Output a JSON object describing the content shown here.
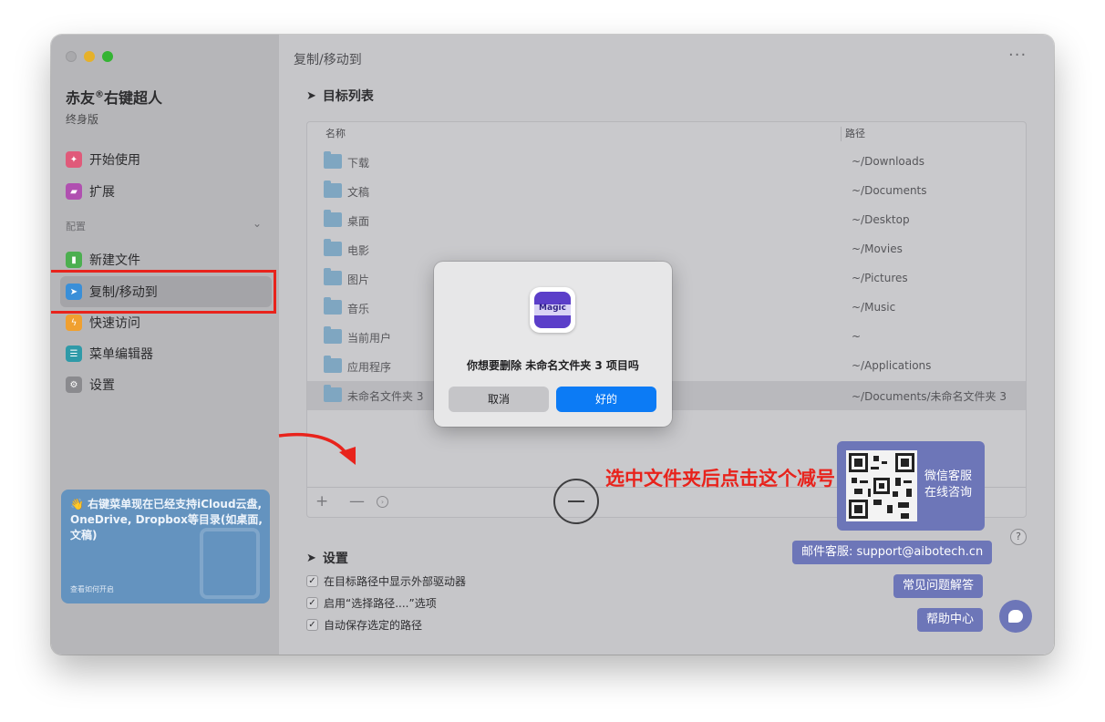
{
  "app": {
    "name": "赤友",
    "registered_mark": "®",
    "name_suffix": "右键超人",
    "edition": "终身版"
  },
  "sidebar": {
    "items_top": [
      {
        "label": "开始使用",
        "icon": "lightbulb-icon",
        "color": "#e05a7a"
      },
      {
        "label": "扩展",
        "icon": "extension-icon",
        "color": "#b050b0"
      }
    ],
    "section_label": "配置",
    "items_config": [
      {
        "label": "新建文件",
        "icon": "new-file-icon",
        "color": "#4caf50"
      },
      {
        "label": "复制/移动到",
        "icon": "send-icon",
        "color": "#3a8fd8",
        "selected": true
      },
      {
        "label": "快速访问",
        "icon": "lightning-icon",
        "color": "#f0a030"
      },
      {
        "label": "菜单编辑器",
        "icon": "list-icon",
        "color": "#2f9aa8"
      },
      {
        "label": "设置",
        "icon": "gear-icon",
        "color": "#8a8a8e"
      }
    ]
  },
  "promo": {
    "text": "👋 右键菜单现在已经支持iCloud云盘, OneDrive, Dropbox等目录(如桌面,文稿)",
    "link": "查看如何开启"
  },
  "main": {
    "title": "复制/移动到",
    "more": "···",
    "target_list_title": "目标列表",
    "columns": {
      "name": "名称",
      "path": "路径"
    },
    "rows": [
      {
        "name": "下载",
        "path": "~/Downloads"
      },
      {
        "name": "文稿",
        "path": "~/Documents"
      },
      {
        "name": "桌面",
        "path": "~/Desktop"
      },
      {
        "name": "电影",
        "path": "~/Movies"
      },
      {
        "name": "图片",
        "path": "~/Pictures"
      },
      {
        "name": "音乐",
        "path": "~/Music"
      },
      {
        "name": "当前用户",
        "path": "~"
      },
      {
        "name": "应用程序",
        "path": "~/Applications"
      },
      {
        "name": "未命名文件夹 3",
        "path": "~/Documents/未命名文件夹 3",
        "selected": true
      }
    ],
    "toolbar": {
      "add": "+",
      "remove": "—",
      "info": "›"
    },
    "settings_title": "设置",
    "settings": [
      {
        "label": "在目标路径中显示外部驱动器",
        "checked": true
      },
      {
        "label": "启用“选择路径....”选项",
        "checked": true
      },
      {
        "label": "自动保存选定的路径",
        "checked": true
      }
    ]
  },
  "annotation": {
    "text": "选中文件夹后点击这个减号"
  },
  "support": {
    "qr_label": "微信客服\n在线咨询",
    "qr_line1": "微信客服",
    "qr_line2": "在线咨询",
    "email": "邮件客服: support@aibotech.cn",
    "faq": "常见问题解答",
    "help_center": "帮助中心",
    "help_q": "?"
  },
  "dialog": {
    "icon_text": "Magic",
    "message": "你想要删除 未命名文件夹 3 项目吗",
    "cancel": "取消",
    "ok": "好的"
  },
  "colors": {
    "accent_blue": "#0c7bf5",
    "annotation_red": "#e8231c",
    "support_purple": "#6d76b8"
  }
}
